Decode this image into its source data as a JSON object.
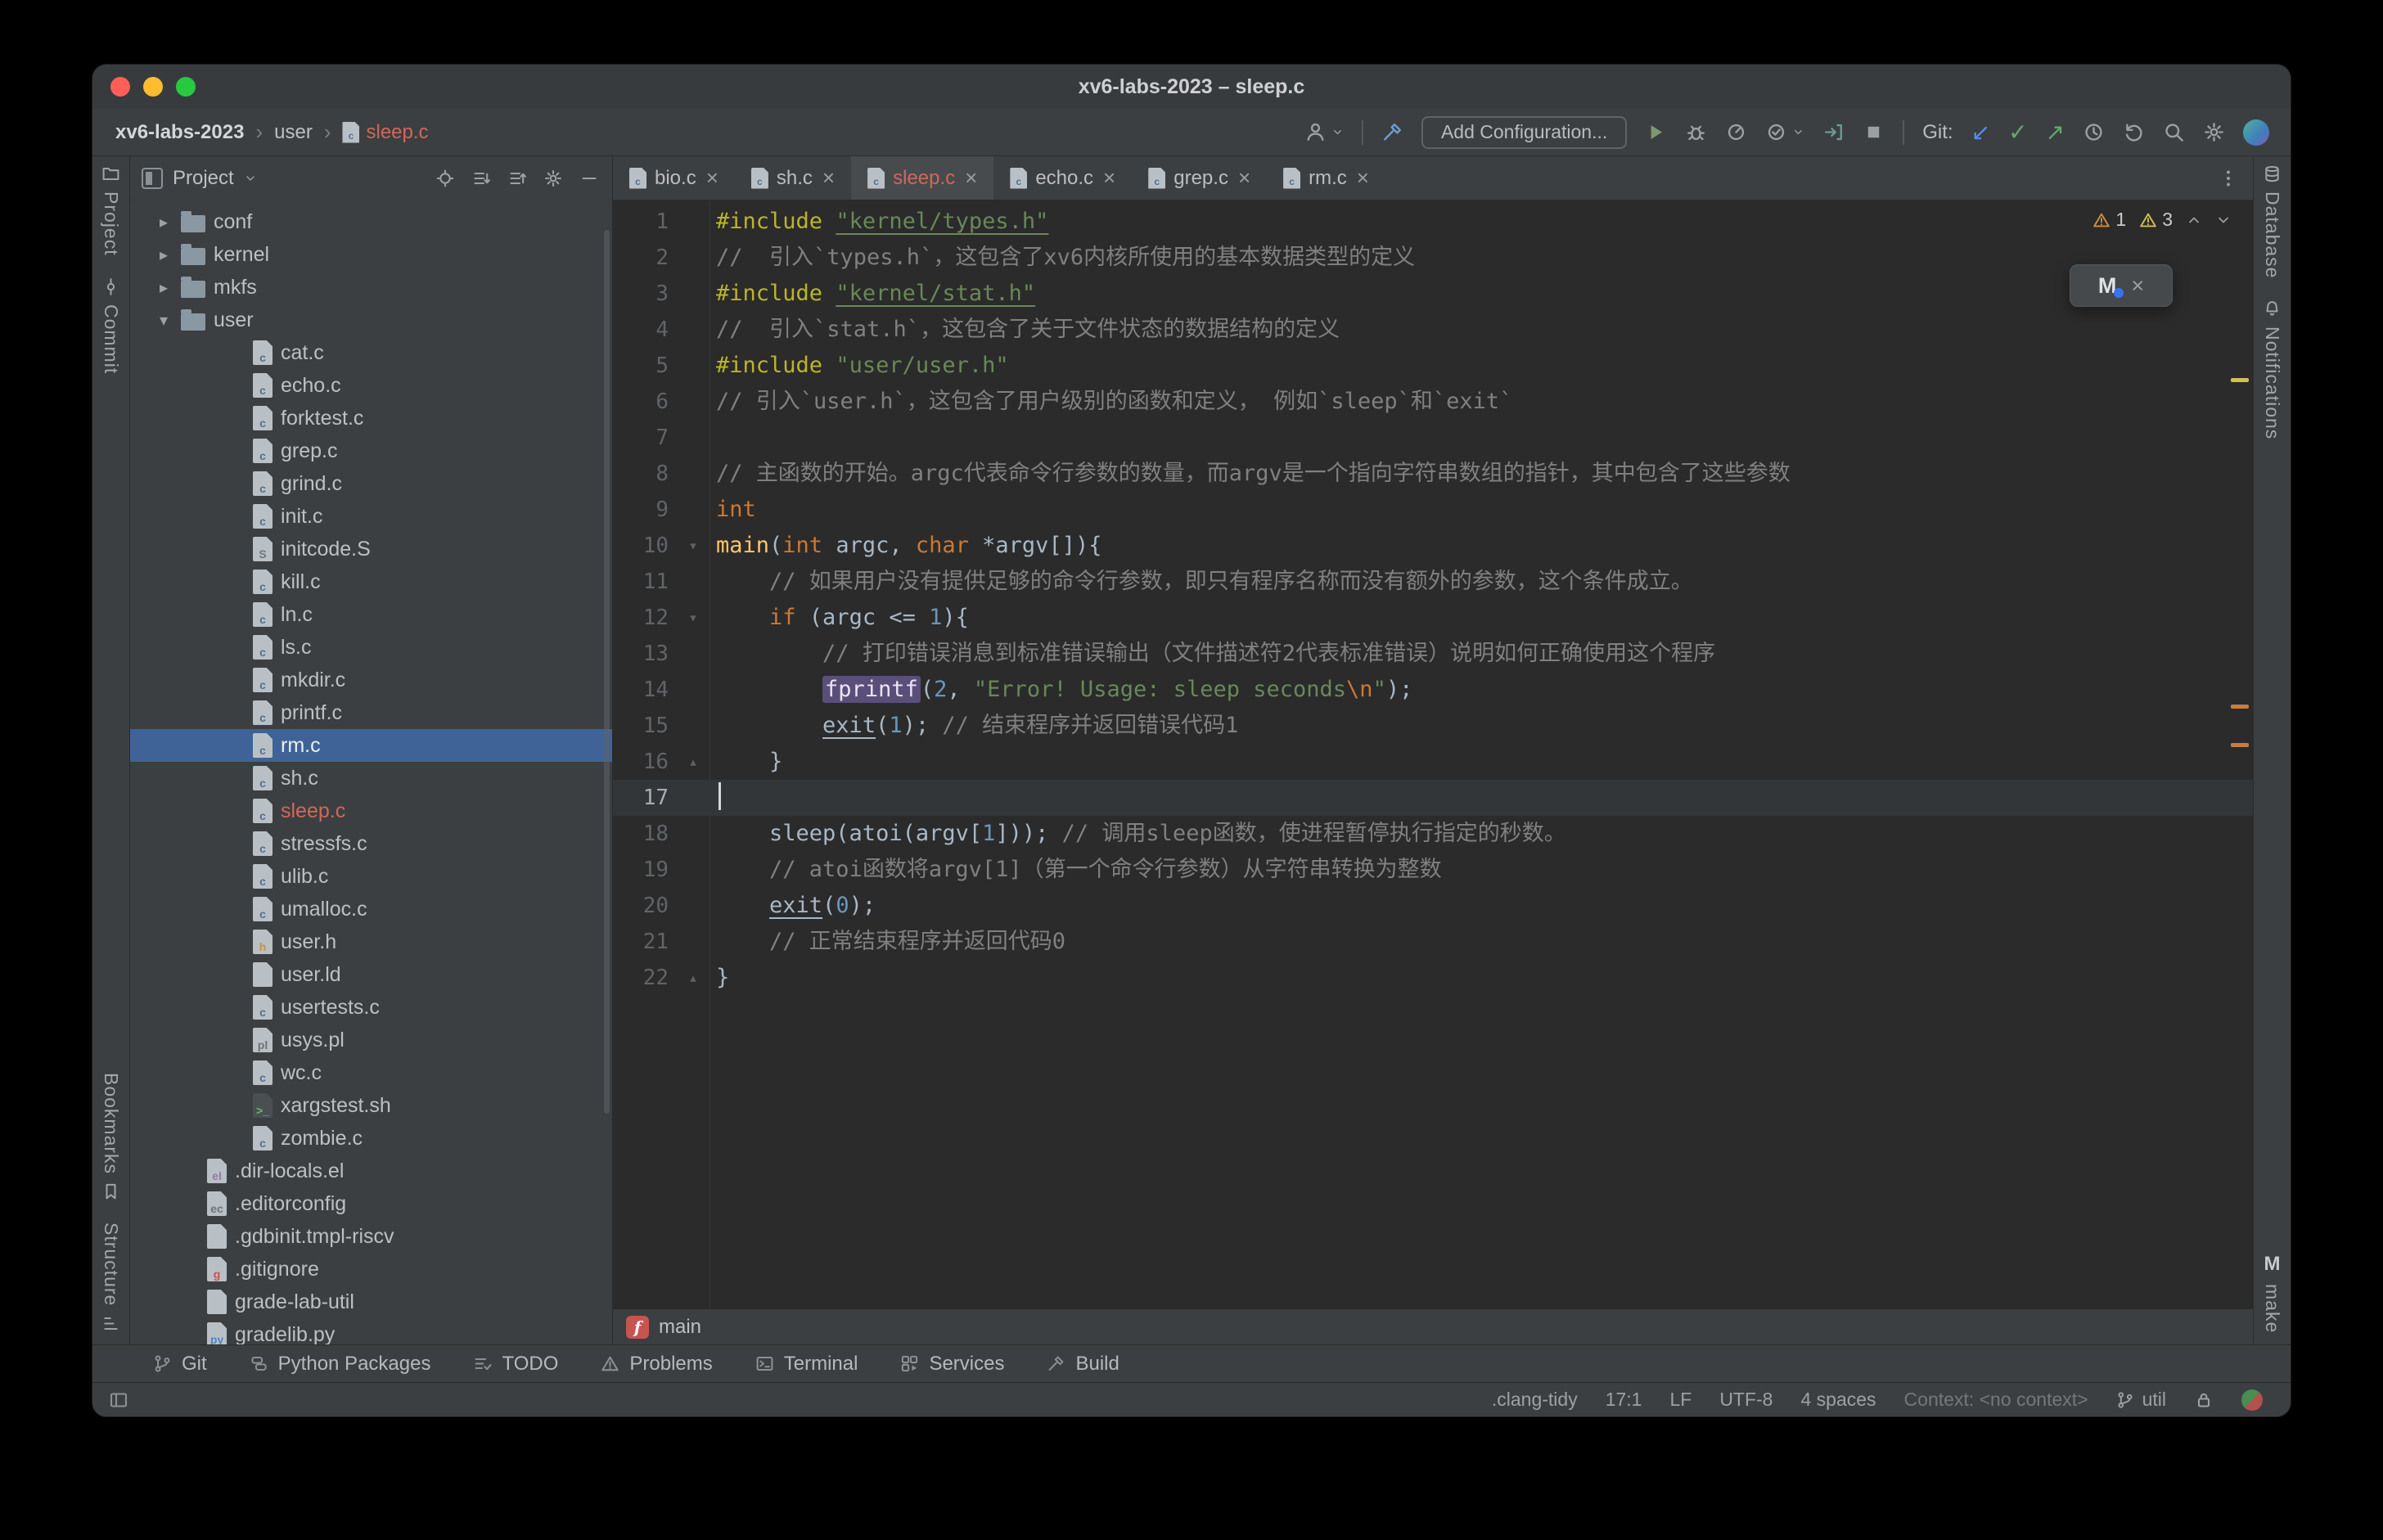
{
  "window": {
    "title": "xv6-labs-2023 – sleep.c"
  },
  "colors": {
    "window_bg": "#3c3f41",
    "editor_bg": "#2b2b2b",
    "selection_blue": "#3f6396",
    "vcs_red": "#d1675a",
    "keyword_orange": "#cc7832",
    "string_green": "#6a8759",
    "number_blue": "#6897bb",
    "comment_gray": "#808080",
    "directive_yellow": "#bbb529",
    "function_yellow": "#ffc66b",
    "highlight_purple": "#5a4f7a",
    "traffic_red": "#ff5f57",
    "traffic_yellow": "#febc2e",
    "traffic_green": "#28c840"
  },
  "breadcrumbs": {
    "items": [
      "xv6-labs-2023",
      "user",
      "sleep.c"
    ]
  },
  "toolbar": {
    "right_items": [
      {
        "type": "icon",
        "name": "user-menu-button",
        "icon": "user-icon",
        "chevron": true
      },
      {
        "type": "divider"
      },
      {
        "type": "icon",
        "name": "build-hammer-button",
        "icon": "build-icon",
        "color": "#6a9fd8"
      },
      {
        "type": "button",
        "name": "add-configuration-button",
        "label": "Add Configuration..."
      },
      {
        "type": "icon",
        "name": "run-button",
        "icon": "play-icon",
        "color": "#7d9a6f"
      },
      {
        "type": "icon",
        "name": "debug-button",
        "icon": "bug-icon"
      },
      {
        "type": "icon",
        "name": "run-with-profiler-button",
        "icon": "profiler-icon"
      },
      {
        "type": "icon",
        "name": "run-with-coverage-button",
        "icon": "coverage-icon",
        "chevron": true
      },
      {
        "type": "icon",
        "name": "attach-to-process-button",
        "icon": "attach-icon",
        "color": "#6d9a94"
      },
      {
        "type": "icon",
        "name": "stop-button",
        "icon": "stop-icon"
      },
      {
        "type": "divider"
      },
      {
        "type": "label",
        "name": "git-label",
        "label": "Git:"
      },
      {
        "type": "glyph",
        "name": "git-update-button",
        "glyph": "↙",
        "color": "#548af7"
      },
      {
        "type": "glyph",
        "name": "git-commit-button",
        "glyph": "✓",
        "color": "#5fad65"
      },
      {
        "type": "glyph",
        "name": "git-push-button",
        "glyph": "↗",
        "color": "#5fad65"
      },
      {
        "type": "icon",
        "name": "history-button",
        "icon": "clock-icon"
      },
      {
        "type": "icon",
        "name": "rollback-button",
        "icon": "rollback-icon"
      },
      {
        "type": "icon",
        "name": "search-everywhere-button",
        "icon": "search-icon"
      },
      {
        "type": "icon",
        "name": "settings-button",
        "icon": "settings-gear-icon"
      },
      {
        "type": "avatar",
        "name": "user-avatar"
      }
    ]
  },
  "stripes": {
    "left_top": [
      {
        "label": "Project",
        "icon": "folder-icon",
        "name": "toolwindow-project"
      },
      {
        "label": "Commit",
        "icon": "commit-icon",
        "name": "toolwindow-commit"
      }
    ],
    "left_bottom": [
      {
        "label": "Bookmarks",
        "icon": "bookmark-icon",
        "name": "toolwindow-bookmarks"
      },
      {
        "label": "Structure",
        "icon": "structure-icon",
        "name": "toolwindow-structure"
      }
    ],
    "right_top": [
      {
        "label": "Database",
        "icon": "database-icon",
        "name": "toolwindow-database"
      },
      {
        "label": "Notifications",
        "icon": "bell-icon",
        "name": "toolwindow-notifications"
      }
    ],
    "right_bottom": [
      {
        "label": "make",
        "letter": "M",
        "name": "toolwindow-make"
      }
    ]
  },
  "project_panel": {
    "title": "Project",
    "header_icons": [
      "locate-icon",
      "expand-all-icon",
      "collapse-all-icon",
      "settings-gear-icon",
      "hide-icon"
    ],
    "tree": [
      {
        "name": "conf",
        "type": "folder",
        "chevron": "right"
      },
      {
        "name": "kernel",
        "type": "folder",
        "chevron": "right"
      },
      {
        "name": "mkfs",
        "type": "folder",
        "chevron": "right"
      },
      {
        "name": "user",
        "type": "folder",
        "chevron": "down"
      },
      {
        "name": "cat.c",
        "type": "file",
        "icon": "c"
      },
      {
        "name": "echo.c",
        "type": "file",
        "icon": "c"
      },
      {
        "name": "forktest.c",
        "type": "file",
        "icon": "c"
      },
      {
        "name": "grep.c",
        "type": "file",
        "icon": "c"
      },
      {
        "name": "grind.c",
        "type": "file",
        "icon": "c"
      },
      {
        "name": "init.c",
        "type": "file",
        "icon": "c"
      },
      {
        "name": "initcode.S",
        "type": "file",
        "icon": "S"
      },
      {
        "name": "kill.c",
        "type": "file",
        "icon": "c"
      },
      {
        "name": "ln.c",
        "type": "file",
        "icon": "c"
      },
      {
        "name": "ls.c",
        "type": "file",
        "icon": "c"
      },
      {
        "name": "mkdir.c",
        "type": "file",
        "icon": "c"
      },
      {
        "name": "printf.c",
        "type": "file",
        "icon": "c"
      },
      {
        "name": "rm.c",
        "type": "file",
        "icon": "c",
        "selected": true
      },
      {
        "name": "sh.c",
        "type": "file",
        "icon": "c"
      },
      {
        "name": "sleep.c",
        "type": "file",
        "icon": "c",
        "vcs": "red"
      },
      {
        "name": "stressfs.c",
        "type": "file",
        "icon": "c"
      },
      {
        "name": "ulib.c",
        "type": "file",
        "icon": "c"
      },
      {
        "name": "umalloc.c",
        "type": "file",
        "icon": "c"
      },
      {
        "name": "user.h",
        "type": "file",
        "icon": "h"
      },
      {
        "name": "user.ld",
        "type": "file",
        "icon": "txt"
      },
      {
        "name": "usertests.c",
        "type": "file",
        "icon": "c"
      },
      {
        "name": "usys.pl",
        "type": "file",
        "icon": "pl"
      },
      {
        "name": "wc.c",
        "type": "file",
        "icon": "c"
      },
      {
        "name": "xargstest.sh",
        "type": "file",
        "icon": "sh"
      },
      {
        "name": "zombie.c",
        "type": "file",
        "icon": "c"
      },
      {
        "name": ".dir-locals.el",
        "type": "rootfile",
        "icon": "el"
      },
      {
        "name": ".editorconfig",
        "type": "rootfile",
        "icon": "cfg"
      },
      {
        "name": ".gdbinit.tmpl-riscv",
        "type": "rootfile",
        "icon": "txt"
      },
      {
        "name": ".gitignore",
        "type": "rootfile",
        "icon": "git"
      },
      {
        "name": "grade-lab-util",
        "type": "rootfile",
        "icon": "txt"
      },
      {
        "name": "gradelib.py",
        "type": "rootfile",
        "icon": "py"
      }
    ],
    "icon_letters": {
      "c": "c",
      "h": "h",
      "S": "S",
      "pl": "pl",
      "sh": ">_",
      "py": "py",
      "el": "el",
      "cfg": "ec",
      "git": "g",
      "txt": ""
    }
  },
  "tabs": {
    "items": [
      {
        "label": "bio.c"
      },
      {
        "label": "sh.c"
      },
      {
        "label": "sleep.c",
        "active": true,
        "red": true
      },
      {
        "label": "echo.c"
      },
      {
        "label": "grep.c"
      },
      {
        "label": "rm.c"
      }
    ],
    "close_glyph": "×"
  },
  "editor": {
    "current_line": 17,
    "folds": {
      "10": "open",
      "12": "open",
      "16": "close",
      "22": "close"
    },
    "stripe_marks": [
      {
        "top_pct": 16,
        "color": "#d2c04f"
      },
      {
        "top_pct": 45.5,
        "color": "#c77d40"
      },
      {
        "top_pct": 49,
        "color": "#c77d40"
      }
    ],
    "lines": [
      {
        "n": 1,
        "s": [
          {
            "t": "#include ",
            "c": "dir"
          },
          {
            "t": "\"kernel/types.h\"",
            "c": "stru"
          }
        ]
      },
      {
        "n": 2,
        "s": [
          {
            "t": "//  引入`types.h`，这包含了xv6内核所使用的基本数据类型的定义",
            "c": "cmt"
          }
        ]
      },
      {
        "n": 3,
        "s": [
          {
            "t": "#include ",
            "c": "dir"
          },
          {
            "t": "\"kernel/stat.h\"",
            "c": "stru"
          }
        ]
      },
      {
        "n": 4,
        "s": [
          {
            "t": "//  引入`stat.h`，这包含了关于文件状态的数据结构的定义",
            "c": "cmt"
          }
        ]
      },
      {
        "n": 5,
        "s": [
          {
            "t": "#include ",
            "c": "dir"
          },
          {
            "t": "\"user/user.h\"",
            "c": "str"
          }
        ]
      },
      {
        "n": 6,
        "s": [
          {
            "t": "// 引入`user.h`，这包含了用户级别的函数和定义， 例如`sleep`和`exit`",
            "c": "cmt"
          }
        ]
      },
      {
        "n": 7,
        "s": []
      },
      {
        "n": 8,
        "s": [
          {
            "t": "// 主函数的开始。argc代表命令行参数的数量，而argv是一个指向字符串数组的指针，其中包含了这些参数",
            "c": "cmt"
          }
        ]
      },
      {
        "n": 9,
        "s": [
          {
            "t": "int",
            "c": "kw"
          }
        ]
      },
      {
        "n": 10,
        "s": [
          {
            "t": "main",
            "c": "fn"
          },
          {
            "t": "(",
            "c": "pl"
          },
          {
            "t": "int",
            "c": "kw"
          },
          {
            "t": " argc, ",
            "c": "pl"
          },
          {
            "t": "char",
            "c": "kw"
          },
          {
            "t": " *argv[]){",
            "c": "pl"
          }
        ]
      },
      {
        "n": 11,
        "s": [
          {
            "t": "    ",
            "c": "pl"
          },
          {
            "t": "// 如果用户没有提供足够的命令行参数，即只有程序名称而没有额外的参数，这个条件成立。",
            "c": "cmt"
          }
        ]
      },
      {
        "n": 12,
        "s": [
          {
            "t": "    ",
            "c": "pl"
          },
          {
            "t": "if",
            "c": "kw"
          },
          {
            "t": " (argc <= ",
            "c": "pl"
          },
          {
            "t": "1",
            "c": "num"
          },
          {
            "t": "){",
            "c": "pl"
          }
        ]
      },
      {
        "n": 13,
        "s": [
          {
            "t": "        ",
            "c": "pl"
          },
          {
            "t": "// 打印错误消息到标准错误输出（文件描述符2代表标准错误）说明如何正确使用这个程序",
            "c": "cmt"
          }
        ]
      },
      {
        "n": 14,
        "s": [
          {
            "t": "        ",
            "c": "pl"
          },
          {
            "t": "fprintf",
            "c": "fnhl"
          },
          {
            "t": "(",
            "c": "pl"
          },
          {
            "t": "2",
            "c": "num"
          },
          {
            "t": ", ",
            "c": "pl"
          },
          {
            "t": "\"Error! Usage: sleep seconds",
            "c": "str"
          },
          {
            "t": "\\n",
            "c": "esc"
          },
          {
            "t": "\"",
            "c": "str"
          },
          {
            "t": ");",
            "c": "pl"
          }
        ]
      },
      {
        "n": 15,
        "s": [
          {
            "t": "        ",
            "c": "pl"
          },
          {
            "t": "exit",
            "c": "und"
          },
          {
            "t": "(",
            "c": "pl"
          },
          {
            "t": "1",
            "c": "num"
          },
          {
            "t": "); ",
            "c": "pl"
          },
          {
            "t": "// 结束程序并返回错误代码1",
            "c": "cmt"
          }
        ]
      },
      {
        "n": 16,
        "s": [
          {
            "t": "    }",
            "c": "pl"
          }
        ]
      },
      {
        "n": 17,
        "s": []
      },
      {
        "n": 18,
        "s": [
          {
            "t": "    sleep(atoi(argv[",
            "c": "pl"
          },
          {
            "t": "1",
            "c": "num"
          },
          {
            "t": "])); ",
            "c": "pl"
          },
          {
            "t": "// 调用sleep函数，使进程暂停执行指定的秒数。",
            "c": "cmt"
          }
        ]
      },
      {
        "n": 19,
        "s": [
          {
            "t": "    ",
            "c": "pl"
          },
          {
            "t": "// atoi函数将argv[1]（第一个命令行参数）从字符串转换为整数",
            "c": "cmt"
          }
        ]
      },
      {
        "n": 20,
        "s": [
          {
            "t": "    ",
            "c": "pl"
          },
          {
            "t": "exit",
            "c": "und"
          },
          {
            "t": "(",
            "c": "pl"
          },
          {
            "t": "0",
            "c": "num"
          },
          {
            "t": ");",
            "c": "pl"
          }
        ]
      },
      {
        "n": 21,
        "s": [
          {
            "t": "    ",
            "c": "pl"
          },
          {
            "t": "// 正常结束程序并返回代码0",
            "c": "cmt"
          }
        ]
      },
      {
        "n": 22,
        "s": [
          {
            "t": "}",
            "c": "pl"
          }
        ]
      }
    ]
  },
  "inspections": {
    "items": [
      {
        "icon": "warning-icon",
        "count": "1",
        "color": "#cf8e3f"
      },
      {
        "icon": "warning-icon",
        "count": "3",
        "color": "#d2c04f"
      }
    ]
  },
  "popup": {
    "label": "M",
    "close_glyph": "×"
  },
  "fn_breadcrumb": {
    "label": "main",
    "badge": "f"
  },
  "bottom_toolbar": [
    {
      "label": "Git",
      "icon": "git-branch-icon",
      "name": "tool-git"
    },
    {
      "label": "Python Packages",
      "icon": "python-icon",
      "name": "tool-python-packages"
    },
    {
      "label": "TODO",
      "icon": "todo-icon",
      "name": "tool-todo"
    },
    {
      "label": "Problems",
      "icon": "problems-icon",
      "name": "tool-problems"
    },
    {
      "label": "Terminal",
      "icon": "terminal-icon",
      "name": "tool-terminal"
    },
    {
      "label": "Services",
      "icon": "services-icon",
      "name": "tool-services"
    },
    {
      "label": "Build",
      "icon": "build-icon",
      "name": "tool-build"
    }
  ],
  "status_bar": {
    "items": [
      {
        "label": ".clang-tidy",
        "name": "clang-tidy-status"
      },
      {
        "label": "17:1",
        "name": "caret-position"
      },
      {
        "label": "LF",
        "name": "line-ending"
      },
      {
        "label": "UTF-8",
        "name": "file-encoding"
      },
      {
        "label": "4 spaces",
        "name": "indent-style"
      },
      {
        "label": "Context: <no context>",
        "name": "resolve-context",
        "dim": true
      },
      {
        "label": "util",
        "name": "git-branch",
        "icon": "git-branch-icon"
      }
    ],
    "extra_icons": [
      "lock-icon",
      "inspections-profile-icon"
    ]
  }
}
